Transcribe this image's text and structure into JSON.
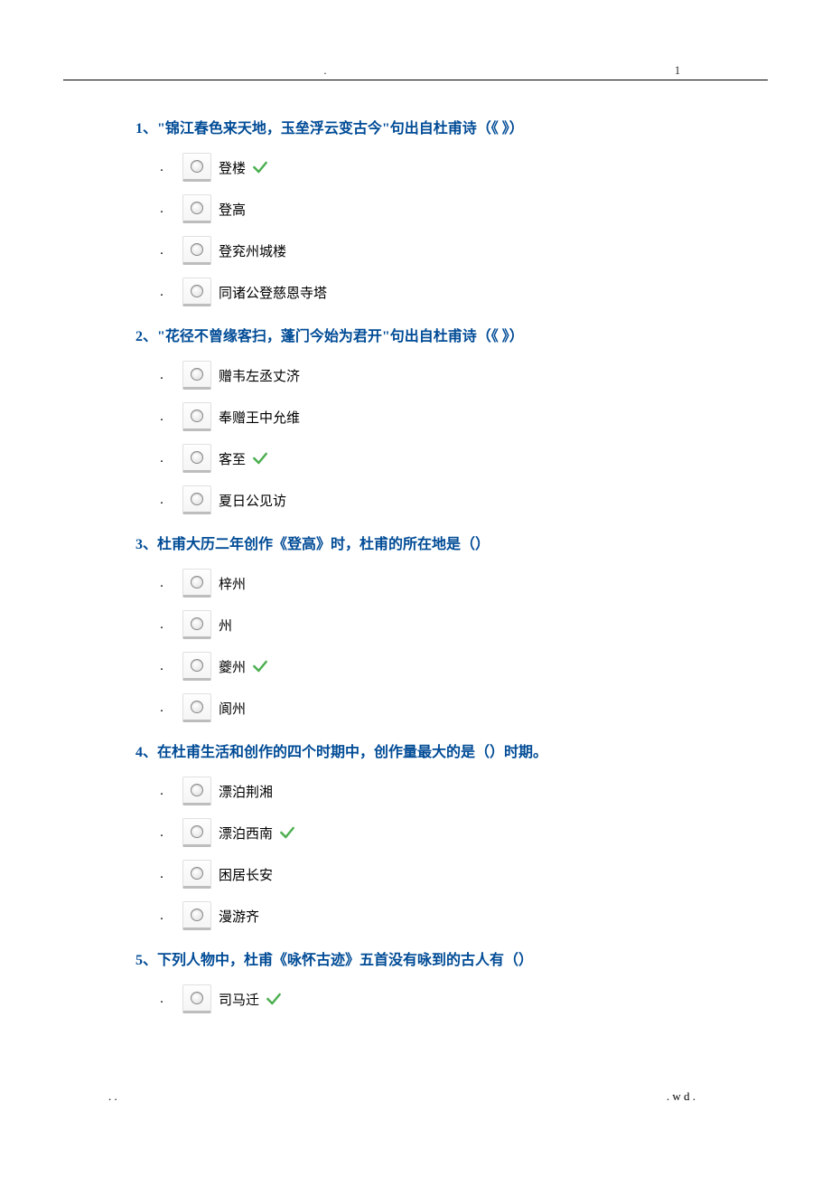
{
  "header": {
    "left_mark": ".",
    "page_number": "1"
  },
  "questions": [
    {
      "title": "1、\"锦江春色来天地，玉垒浮云变古今\"句出自杜甫诗（《  》）",
      "options": [
        {
          "label": "登楼",
          "correct": true
        },
        {
          "label": "登高",
          "correct": false
        },
        {
          "label": "登兖州城楼",
          "correct": false
        },
        {
          "label": "同诸公登慈恩寺塔",
          "correct": false
        }
      ]
    },
    {
      "title": "2、\"花径不曾缘客扫，蓬门今始为君开\"句出自杜甫诗（《   》）",
      "options": [
        {
          "label": "赠韦左丞丈济",
          "correct": false
        },
        {
          "label": "奉赠王中允维",
          "correct": false
        },
        {
          "label": "客至",
          "correct": true
        },
        {
          "label": "夏日公见访",
          "correct": false
        }
      ]
    },
    {
      "title": "3、杜甫大历二年创作《登高》时，杜甫的所在地是（）",
      "options": [
        {
          "label": "梓州",
          "correct": false
        },
        {
          "label": "州",
          "correct": false
        },
        {
          "label": "夔州",
          "correct": true
        },
        {
          "label": "阆州",
          "correct": false
        }
      ]
    },
    {
      "title": "4、在杜甫生活和创作的四个时期中，创作量最大的是（）时期。",
      "options": [
        {
          "label": "漂泊荆湘",
          "correct": false
        },
        {
          "label": "漂泊西南",
          "correct": true
        },
        {
          "label": "困居长安",
          "correct": false
        },
        {
          "label": "漫游齐",
          "correct": false
        }
      ]
    },
    {
      "title": "5、下列人物中，杜甫《咏怀古迹》五首没有咏到的古人有（）",
      "options": [
        {
          "label": "司马迁",
          "correct": true
        }
      ]
    }
  ],
  "footer": {
    "left": ". .",
    "right": ".   w d ."
  }
}
